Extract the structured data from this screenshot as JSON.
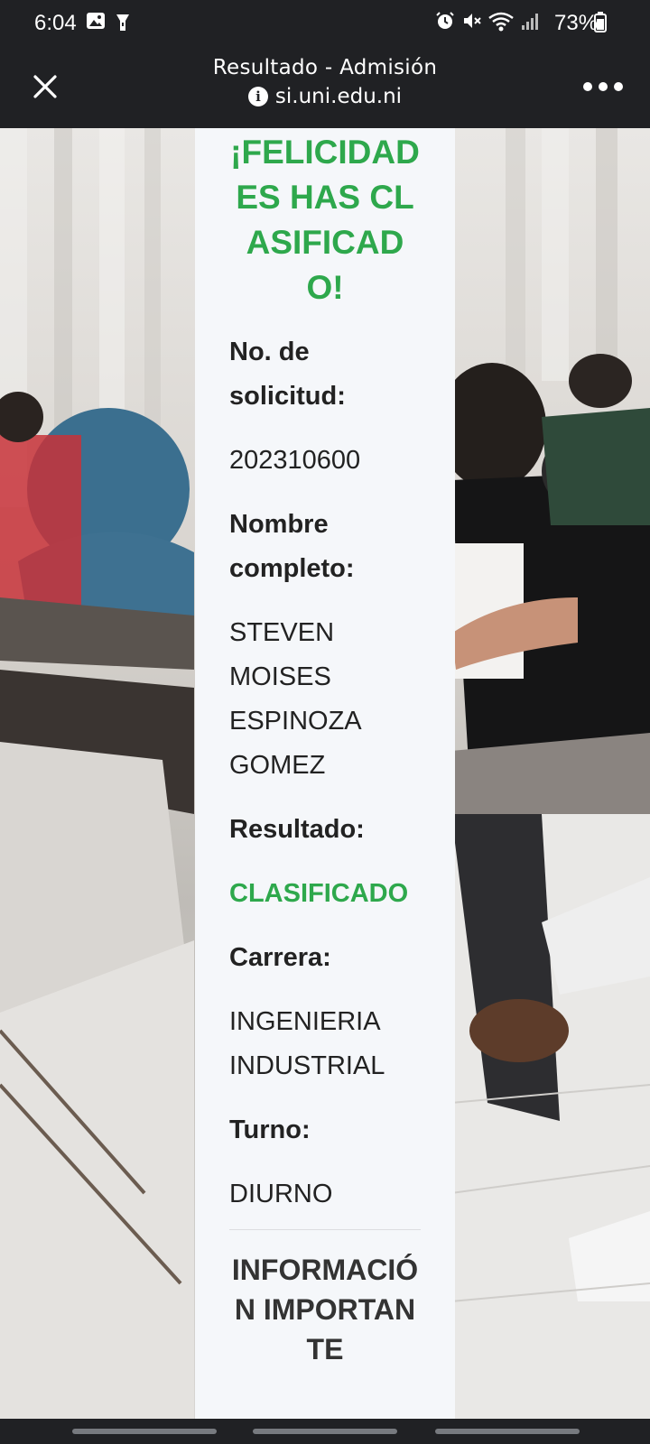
{
  "status_bar": {
    "time": "6:04",
    "battery": "73%",
    "icons": [
      "gallery-icon",
      "flashlight-icon",
      "alarm-icon",
      "mute-icon",
      "wifi-icon",
      "signal-icon",
      "battery-icon"
    ]
  },
  "browser": {
    "title": "Resultado - Admisión",
    "url": "si.uni.edu.ni",
    "close_icon": "close-icon",
    "more_icon": "more-icon",
    "info_icon": "info-icon"
  },
  "result": {
    "heading": "¡FELICIDADES HAS CLASIFICADO!",
    "fields": [
      {
        "label": "No. de solicitud:",
        "value": "202310600"
      },
      {
        "label": "Nombre completo:",
        "value": "STEVEN MOISES ESPINOZA GOMEZ"
      },
      {
        "label": "Resultado:",
        "value": "CLASIFICADO"
      },
      {
        "label": "Carrera:",
        "value": "INGENIERIA INDUSTRIAL"
      },
      {
        "label": "Turno:",
        "value": "DIURNO"
      }
    ],
    "info_heading": "INFORMACIÓN IMPORTANTE"
  },
  "colors": {
    "accent_green": "#2ea84c",
    "card_bg": "#f5f7fa",
    "chrome_bg": "#202124"
  }
}
